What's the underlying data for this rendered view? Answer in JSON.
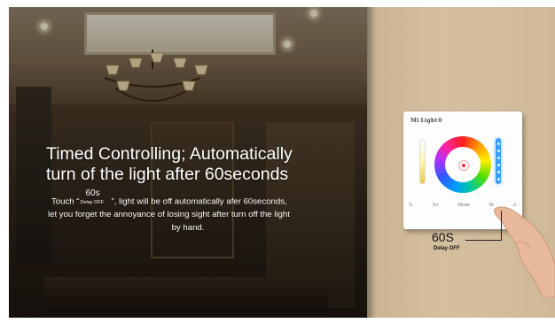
{
  "headline": {
    "line1": "Timed Controlling; Automatically",
    "line2": "turn of the light after 60seconds"
  },
  "body": {
    "line1_prefix": "Touch “",
    "inline_button_big": "60s",
    "inline_button_small": "Delay OFF",
    "line1_suffix": "”, light will be off automatically afer 60seconds,",
    "line2": "let you forget the annoyance of losing sight after turn off the light",
    "line3": "by hand."
  },
  "panel": {
    "logo": "Mi·Light®",
    "buttons": [
      "S-",
      "S+",
      "Mode",
      "W",
      "⊙"
    ]
  },
  "callout": {
    "big": "60S",
    "small": "Delay OFF"
  },
  "colors": {
    "headline": "#ffffff",
    "slider_blue": "#3aa0ff",
    "power_red": "#e33333"
  },
  "icons": {
    "power": "power-icon",
    "hand": "hand-icon",
    "chandelier": "chandelier-icon"
  }
}
